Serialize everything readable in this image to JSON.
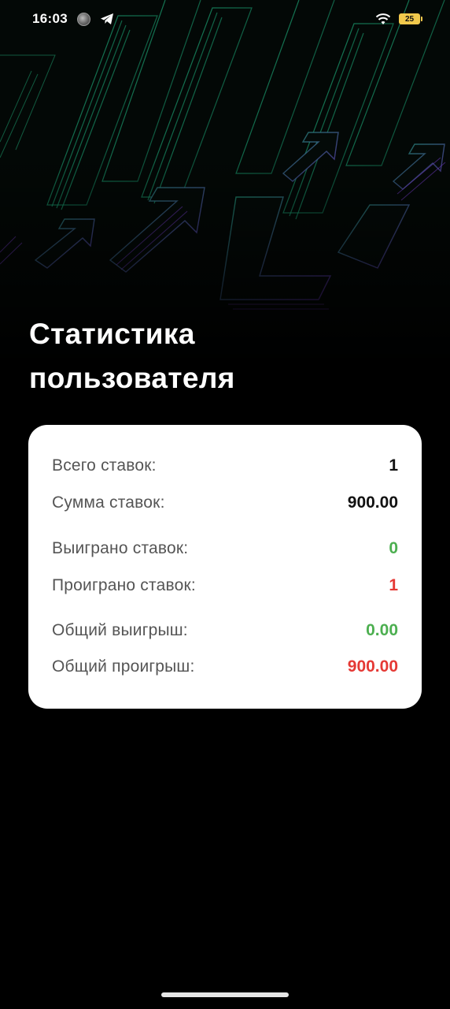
{
  "status_bar": {
    "time": "16:03",
    "battery_level": "25",
    "icons": [
      "avatar-icon",
      "telegram-icon",
      "wifi-icon",
      "battery-icon"
    ]
  },
  "page": {
    "title_line1": "Статистика",
    "title_line2": "пользователя"
  },
  "stats": [
    {
      "label": "Всего ставок:",
      "value": "1",
      "status": "neutral"
    },
    {
      "label": "Сумма ставок:",
      "value": "900.00",
      "status": "neutral"
    },
    {
      "label": "Выиграно ставок:",
      "value": "0",
      "status": "positive"
    },
    {
      "label": "Проиграно ставок:",
      "value": "1",
      "status": "negative"
    },
    {
      "label": "Общий выигрыш:",
      "value": "0.00",
      "status": "positive"
    },
    {
      "label": "Общий проигрыш:",
      "value": "900.00",
      "status": "negative"
    }
  ],
  "colors": {
    "background": "#000000",
    "card": "#ffffff",
    "positive": "#4caf50",
    "negative": "#e53935",
    "accent_green": "#1fae7a",
    "accent_purple": "#7a3fd6"
  }
}
